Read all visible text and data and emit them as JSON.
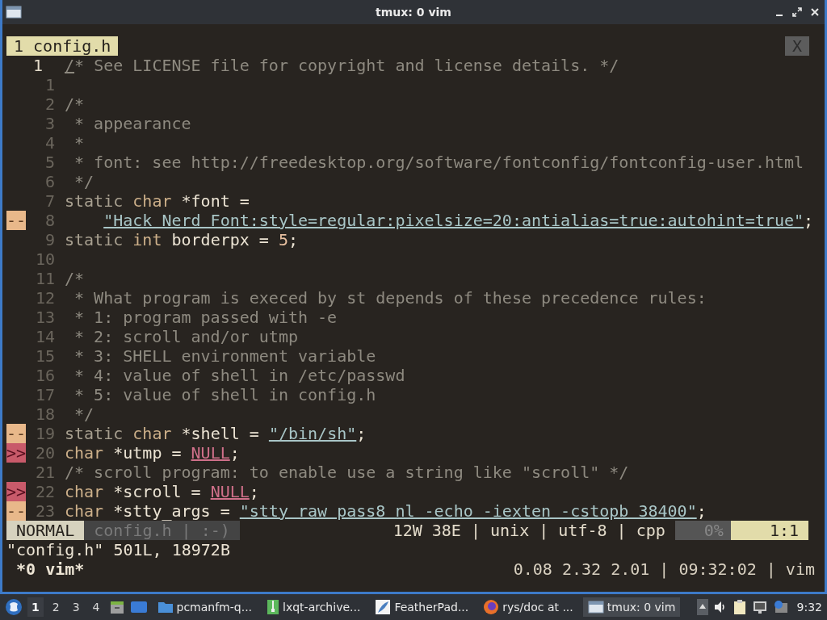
{
  "window": {
    "title": "tmux: 0 vim"
  },
  "tabline": {
    "tabs": [
      {
        "label": "1 config.h",
        "selected": true
      }
    ],
    "close_label": "X"
  },
  "lines": [
    {
      "number": "1",
      "current": true,
      "segments": [
        {
          "kind": "cursor",
          "text": "/"
        },
        {
          "kind": "comment",
          "text": "* See LICENSE file for copyright and license details. */"
        }
      ]
    },
    {
      "number": "1",
      "current": false
    },
    {
      "number": "2",
      "current": false,
      "segments": [
        {
          "kind": "comment",
          "text": "/*"
        }
      ]
    },
    {
      "number": "3",
      "current": false,
      "segments": [
        {
          "kind": "comment",
          "text": " * appearance"
        }
      ]
    },
    {
      "number": "4",
      "current": false,
      "segments": [
        {
          "kind": "comment",
          "text": " *"
        }
      ]
    },
    {
      "number": "5",
      "current": false,
      "segments": [
        {
          "kind": "comment",
          "text": " * font: see http://freedesktop.org/software/fontconfig/fontconfig-user.html"
        }
      ]
    },
    {
      "number": "6",
      "current": false,
      "segments": [
        {
          "kind": "comment",
          "text": " */"
        }
      ]
    },
    {
      "number": "7",
      "current": false,
      "segments": [
        {
          "kind": "keyword",
          "text": "static "
        },
        {
          "kind": "type",
          "text": "char"
        },
        {
          "kind": "plain",
          "text": " *font ="
        }
      ]
    },
    {
      "number": "8",
      "current": false,
      "sign": {
        "kind": "warning",
        "text": "--"
      },
      "indented": true,
      "segments": [
        {
          "kind": "string",
          "text": "\"Hack Nerd Font:style=regular:pixelsize=20:antialias=true:autohint=true\""
        },
        {
          "kind": "plain",
          "text": ";"
        }
      ]
    },
    {
      "number": "9",
      "current": false,
      "segments": [
        {
          "kind": "keyword",
          "text": "static "
        },
        {
          "kind": "type",
          "text": "int"
        },
        {
          "kind": "plain",
          "text": " borderpx = "
        },
        {
          "kind": "number",
          "text": "5"
        },
        {
          "kind": "plain",
          "text": ";"
        }
      ]
    },
    {
      "number": "10",
      "current": false
    },
    {
      "number": "11",
      "current": false,
      "segments": [
        {
          "kind": "comment",
          "text": "/*"
        }
      ]
    },
    {
      "number": "12",
      "current": false,
      "segments": [
        {
          "kind": "comment",
          "text": " * What program is execed by st depends of these precedence rules:"
        }
      ]
    },
    {
      "number": "13",
      "current": false,
      "segments": [
        {
          "kind": "comment",
          "text": " * 1: program passed with -e"
        }
      ]
    },
    {
      "number": "14",
      "current": false,
      "segments": [
        {
          "kind": "comment",
          "text": " * 2: scroll and/or utmp"
        }
      ]
    },
    {
      "number": "15",
      "current": false,
      "segments": [
        {
          "kind": "comment",
          "text": " * 3: SHELL environment variable"
        }
      ]
    },
    {
      "number": "16",
      "current": false,
      "segments": [
        {
          "kind": "comment",
          "text": " * 4: value of shell in /etc/passwd"
        }
      ]
    },
    {
      "number": "17",
      "current": false,
      "segments": [
        {
          "kind": "comment",
          "text": " * 5: value of shell in config.h"
        }
      ]
    },
    {
      "number": "18",
      "current": false,
      "segments": [
        {
          "kind": "comment",
          "text": " */"
        }
      ]
    },
    {
      "number": "19",
      "current": false,
      "sign": {
        "kind": "warning",
        "text": "--"
      },
      "segments": [
        {
          "kind": "keyword",
          "text": "static "
        },
        {
          "kind": "type",
          "text": "char"
        },
        {
          "kind": "plain",
          "text": " *shell = "
        },
        {
          "kind": "string",
          "text": "\"/bin/sh\""
        },
        {
          "kind": "plain",
          "text": ";"
        }
      ]
    },
    {
      "number": "20",
      "current": false,
      "sign": {
        "kind": "error",
        "text": ">>"
      },
      "segments": [
        {
          "kind": "type",
          "text": "char"
        },
        {
          "kind": "plain",
          "text": " *utmp = "
        },
        {
          "kind": "null",
          "text": "NULL"
        },
        {
          "kind": "plain",
          "text": ";"
        }
      ]
    },
    {
      "number": "21",
      "current": false,
      "segments": [
        {
          "kind": "comment",
          "text": "/* scroll program: to enable use a string like \"scroll\" */"
        }
      ]
    },
    {
      "number": "22",
      "current": false,
      "sign": {
        "kind": "error",
        "text": ">>"
      },
      "segments": [
        {
          "kind": "type",
          "text": "char"
        },
        {
          "kind": "plain",
          "text": " *scroll = "
        },
        {
          "kind": "null",
          "text": "NULL"
        },
        {
          "kind": "plain",
          "text": ";"
        }
      ]
    },
    {
      "number": "23",
      "current": false,
      "sign": {
        "kind": "warning",
        "text": "--"
      },
      "segments": [
        {
          "kind": "type",
          "text": "char"
        },
        {
          "kind": "plain",
          "text": " *stty_args = "
        },
        {
          "kind": "string",
          "text": "\"stty raw pass8 nl -echo -iexten -cstopb 38400\""
        },
        {
          "kind": "plain",
          "text": ";"
        }
      ]
    }
  ],
  "statusline": {
    "mode": "NORMAL",
    "file": "config.h | :-)",
    "info": "12W 38E | unix | utf-8 | cpp",
    "percent": "0%",
    "position": "1:1"
  },
  "message": "\"config.h\" 501L, 18972B",
  "tmux": {
    "window": " *0 vim*",
    "status": "0.08 2.32 2.01 | 09:32:02 | vim"
  },
  "taskbar": {
    "workspaces": [
      {
        "label": "1",
        "selected": true
      },
      {
        "label": "2",
        "selected": false
      },
      {
        "label": "3",
        "selected": false
      },
      {
        "label": "4",
        "selected": false
      }
    ],
    "tasks": [
      {
        "label": "pcmanfm-q...",
        "kind": "folder",
        "selected": false
      },
      {
        "label": "lxqt-archive...",
        "kind": "archive",
        "selected": false
      },
      {
        "label": "FeatherPad...",
        "kind": "feather",
        "selected": false
      },
      {
        "label": "rys/doc at ...",
        "kind": "browser",
        "selected": false
      },
      {
        "label": "tmux: 0 vim",
        "kind": "window",
        "selected": true
      }
    ],
    "clock": "9:32"
  }
}
